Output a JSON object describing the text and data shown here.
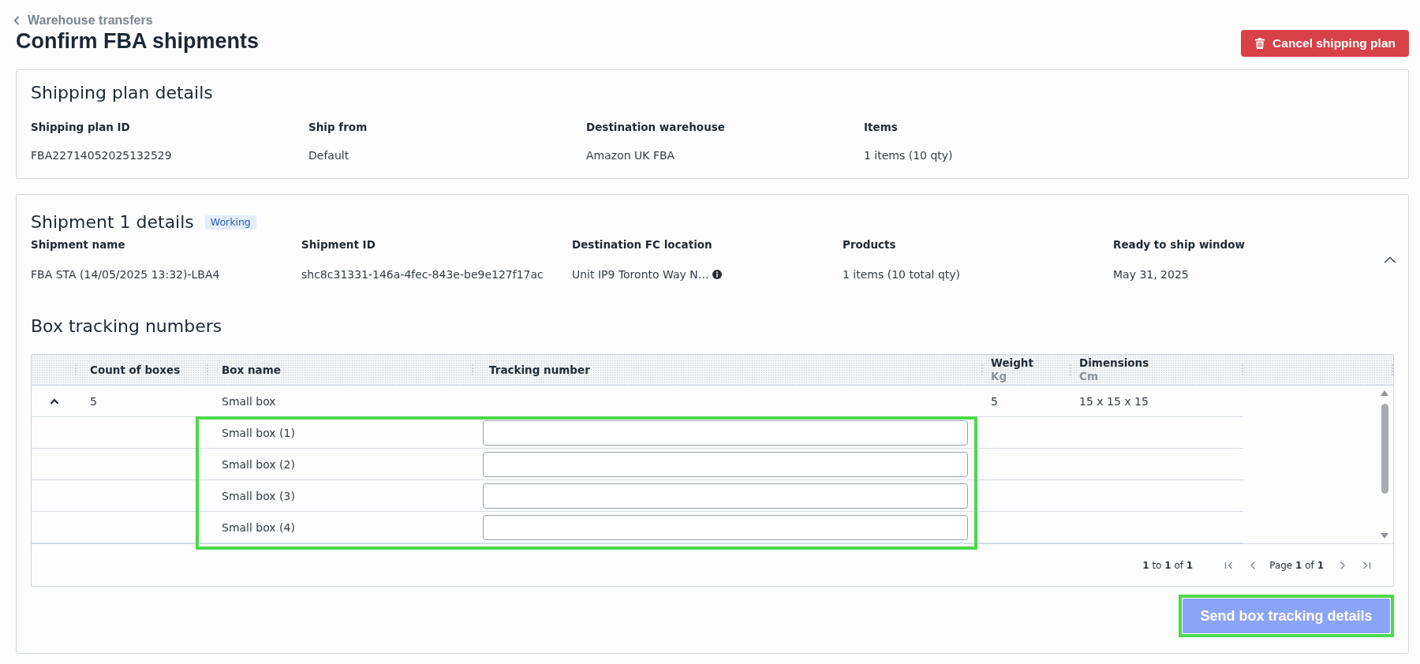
{
  "breadcrumb": {
    "label": "Warehouse transfers"
  },
  "page_title": "Confirm FBA shipments",
  "cancel_button": {
    "label": "Cancel shipping plan"
  },
  "shipping_plan": {
    "title": "Shipping plan details",
    "fields": [
      {
        "label": "Shipping plan ID",
        "value": "FBA22714052025132529"
      },
      {
        "label": "Ship from",
        "value": "Default"
      },
      {
        "label": "Destination warehouse",
        "value": "Amazon UK FBA"
      },
      {
        "label": "Items",
        "value": "1 items (10 qty)"
      }
    ]
  },
  "shipment": {
    "title": "Shipment 1 details",
    "status": "Working",
    "expanded": true,
    "fields": [
      {
        "label": "Shipment name",
        "value": "FBA STA (14/05/2025 13:32)-LBA4",
        "info": false
      },
      {
        "label": "Shipment ID",
        "value": "shc8c31331-146a-4fec-843e-be9e127f17ac",
        "info": false
      },
      {
        "label": "Destination FC location",
        "value": "Unit IP9 Toronto Way N…",
        "info": true
      },
      {
        "label": "Products",
        "value": "1 items (10 total qty)",
        "info": false
      },
      {
        "label": "Ready to ship window",
        "value": "May 31, 2025",
        "info": false
      }
    ],
    "box_tracking": {
      "title": "Box tracking numbers",
      "table": {
        "columns": [
          {
            "label": "Count of boxes"
          },
          {
            "label": "Box name"
          },
          {
            "label": "Tracking number"
          },
          {
            "label": "Weight",
            "unit": "Kg"
          },
          {
            "label": "Dimensions",
            "unit": "Cm"
          }
        ],
        "rows": [
          {
            "count": "5",
            "box_name": "Small box",
            "weight": "5",
            "dimensions": "15 x 15 x 15",
            "expanded": true,
            "highlighted": true,
            "children": [
              {
                "box_name": "Small box (1)"
              },
              {
                "box_name": "Small box (2)"
              },
              {
                "box_name": "Small box (3)"
              },
              {
                "box_name": "Small box (4)"
              }
            ]
          }
        ],
        "pagination": {
          "range": "**1** to **1** of **1**",
          "page": "Page **1** of **1**"
        }
      },
      "send_button": {
        "label": "Send box tracking details",
        "disabled": true,
        "highlighted": true
      }
    }
  }
}
